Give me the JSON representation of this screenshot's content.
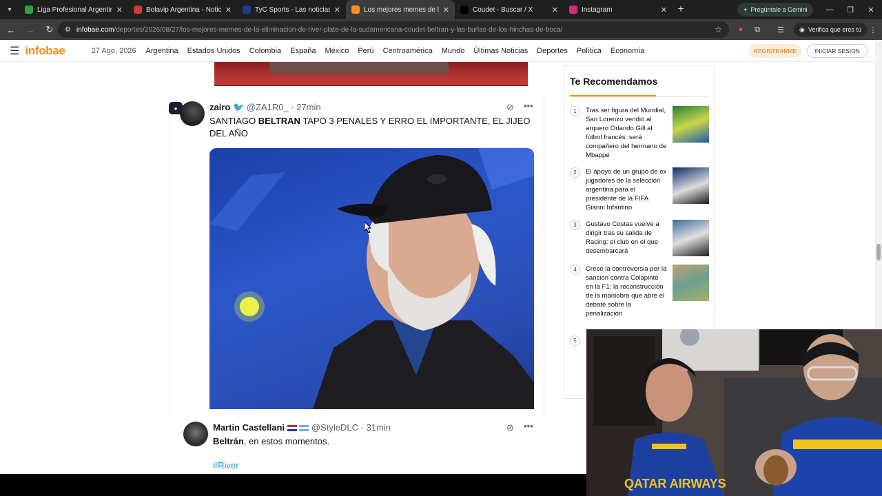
{
  "browser": {
    "tabs": [
      {
        "title": "Liga Profesional Argentina - PO",
        "favicon_color": "#2f9e44",
        "active": false
      },
      {
        "title": "Bolavip Argentina - Noticias de",
        "favicon_color": "#d23a3a",
        "active": false
      },
      {
        "title": "TyC Sports - Las noticias de dep",
        "favicon_color": "#1e3c8c",
        "active": false
      },
      {
        "title": "Los mejores memes de la elimina",
        "favicon_color": "#f68e1e",
        "active": true
      },
      {
        "title": "Coudet - Buscar / X",
        "favicon_color": "#000000",
        "active": false
      },
      {
        "title": "Instagram",
        "favicon_color": "#d6297a",
        "active": false
      }
    ],
    "gemini_label": "Pregúntale a Gemini",
    "url_host": "infobae.com",
    "url_path": "/deportes/2026/08/27/los-mejores-memes-de-la-eliminacion-de-river-plate-de-la-sudamericana-coudet-beltran-y-las-burlas-de-los-hinchas-de-boca/",
    "profile_label": "Verifica que eres tú"
  },
  "site": {
    "logo": "infobae",
    "date": "27 Ago, 2026",
    "nav": [
      "Argentina",
      "Estados Unidos",
      "Colombia",
      "España",
      "México",
      "Perú",
      "Centroamérica",
      "Mundo",
      "Últimas Noticias",
      "Deportes",
      "Política",
      "Economía"
    ],
    "register_label": "REGISTRARME",
    "login_label": "INICIAR SESION"
  },
  "tweets": [
    {
      "name": "zairo",
      "name_suffix": "🐦",
      "handle": "@ZA1R0_ · 27min",
      "text_before": "SANTIAGO ",
      "text_bold": "BELTRAN",
      "text_after": " TAPO 3 PENALES Y ERRO EL IMPORTANTE, EL JIJEO DEL AÑO"
    },
    {
      "name": "Martin Castellani",
      "handle": "@StyleDLC · 31min",
      "text_bold": "Beltrán",
      "text_after": ", en estos momentos.",
      "hashtag": "#River"
    }
  ],
  "recommended": {
    "title": "Te Recomendamos",
    "items": [
      {
        "num": "1",
        "text": "Tras ser figura del Mundial, San Lorenzo vendió al arquero Orlando Gill al fútbol francés: será compañero del hermano de Mbappé"
      },
      {
        "num": "2",
        "text": "El apoyo de un grupo de ex jugadores de la selección argentina para el presidente de la FIFA Gianni Infantino"
      },
      {
        "num": "3",
        "text": "Gustavo Costas vuelve a dirigir tras su salida de Racing: el club en el que desembarcará"
      },
      {
        "num": "4",
        "text": "Crece la controversia por la sanción contra Colapinto en la F1: la reconstrucción de la maniobra que abre el debate sobre la penalización"
      },
      {
        "num": "5",
        "text": ""
      }
    ]
  },
  "webcam": {
    "jersey_text": "QATAR AIRWAYS"
  }
}
